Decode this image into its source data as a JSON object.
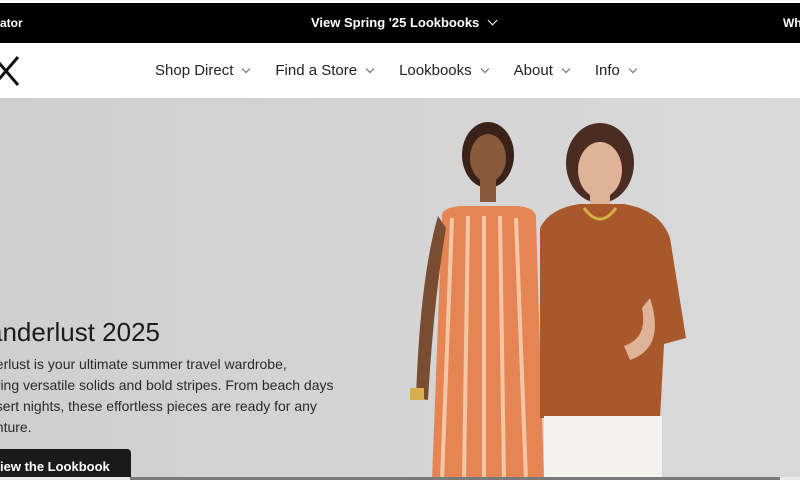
{
  "announcement": {
    "left_text": "ator",
    "center_text": "View Spring '25 Lookbooks",
    "right_text": "Wh"
  },
  "header": {
    "logo_text": "X",
    "nav": [
      {
        "label": "Shop Direct"
      },
      {
        "label": "Find a Store"
      },
      {
        "label": "Lookbooks"
      },
      {
        "label": "About"
      },
      {
        "label": "Info"
      }
    ]
  },
  "hero": {
    "title": "anderlust 2025",
    "copy_lines": [
      "derlust is your ultimate summer travel wardrobe,",
      "uring versatile solids and bold stripes. From beach days",
      "esert nights, these effortless pieces are ready for any",
      "enture."
    ],
    "cta_label": "iew the Lookbook"
  },
  "colors": {
    "bar": "#000000",
    "hero_bg": "#d3d3d3",
    "dress_stripe": "#e07a4a",
    "tunic": "#a8582a",
    "button": "#1a1a1a"
  }
}
